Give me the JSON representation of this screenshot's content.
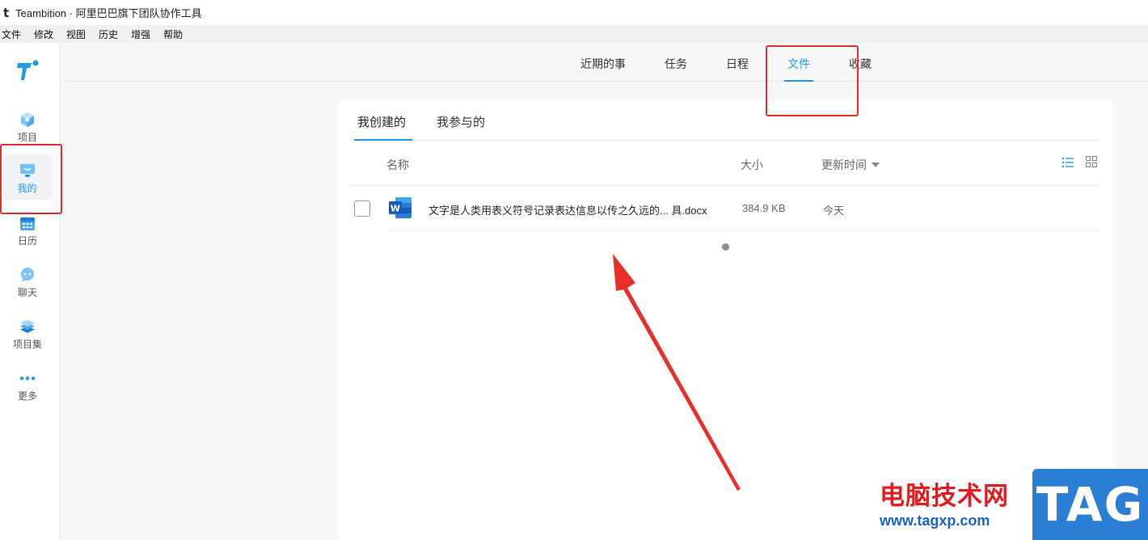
{
  "window": {
    "app_glyph": "t",
    "title": "Teambition · 阿里巴巴旗下团队协作工具"
  },
  "menubar": [
    "文件",
    "修改",
    "视图",
    "历史",
    "增强",
    "帮助"
  ],
  "sidebar": {
    "items": [
      {
        "label": "项目",
        "icon": "project-cube-icon"
      },
      {
        "label": "我的",
        "icon": "mine-monitor-icon",
        "active": true
      },
      {
        "label": "日历",
        "icon": "calendar-icon"
      },
      {
        "label": "聊天",
        "icon": "chat-bubble-icon"
      },
      {
        "label": "项目集",
        "icon": "layers-icon"
      },
      {
        "label": "更多",
        "icon": "more-dots-icon"
      }
    ]
  },
  "topnav": {
    "tabs": [
      {
        "label": "近期的事"
      },
      {
        "label": "任务"
      },
      {
        "label": "日程"
      },
      {
        "label": "文件",
        "active": true
      },
      {
        "label": "收藏"
      }
    ]
  },
  "files": {
    "subtabs": [
      {
        "label": "我创建的",
        "active": true
      },
      {
        "label": "我参与的"
      }
    ],
    "columns": {
      "name": "名称",
      "size": "大小",
      "updated": "更新时间"
    },
    "rows": [
      {
        "name": "文字是人类用表义符号记录表达信息以传之久远的... 具.docx",
        "size": "384.9 KB",
        "updated": "今天",
        "icon": "word-doc-icon",
        "icon_letter": "W"
      }
    ]
  },
  "watermark": {
    "text": "电脑技术网",
    "url": "www.tagxp.com",
    "tag": "TAG"
  },
  "colors": {
    "accent": "#1b9aee",
    "highlight_red": "#e8302a",
    "word_blue": "#185abd"
  }
}
